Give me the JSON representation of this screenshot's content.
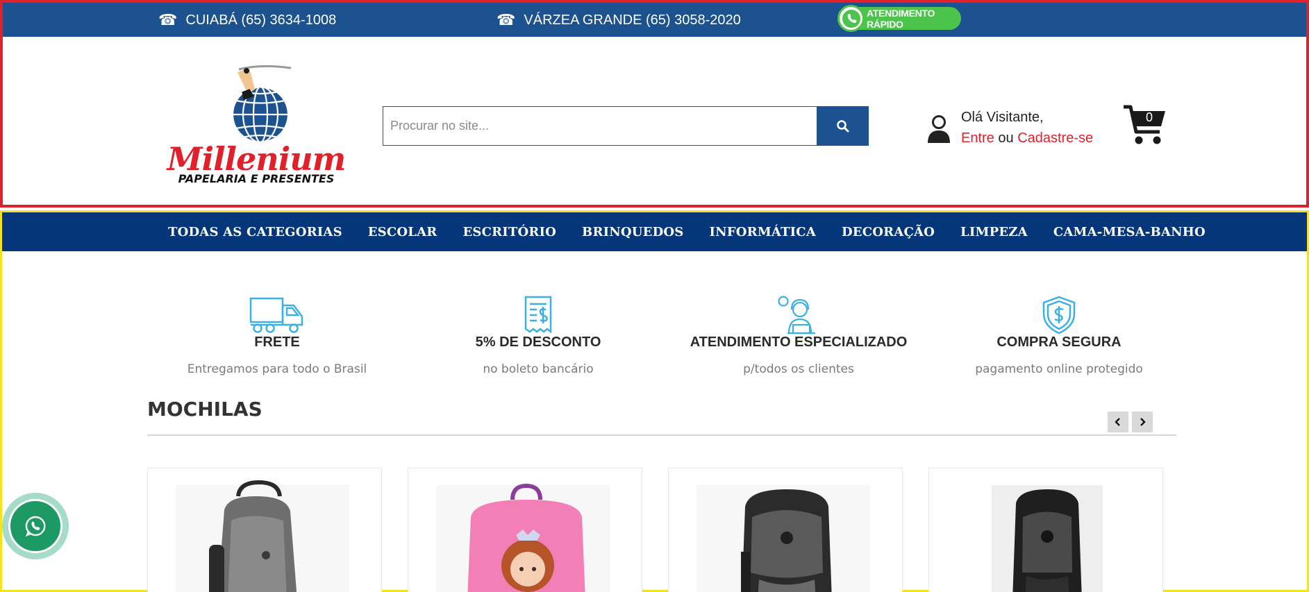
{
  "topbar": {
    "phones": [
      {
        "label": "CUIABÁ (65) 3634-1008",
        "icon": "phone-icon"
      },
      {
        "label": "VÁRZEA GRANDE (65) 3058-2020",
        "icon": "phone-icon"
      }
    ],
    "whatsapp_label": "ATENDIMENTO RÁPIDO"
  },
  "logo": {
    "name": "Millenium",
    "tagline": "PAPELARIA E PRESENTES"
  },
  "search": {
    "placeholder": "Procurar no site...",
    "value": "",
    "button_icon": "search-icon"
  },
  "account": {
    "greeting": "Olá Visitante,",
    "login_label": "Entre",
    "separator": "ou",
    "register_label": "Cadastre-se"
  },
  "cart": {
    "count": "0",
    "icon": "cart-icon"
  },
  "nav": {
    "items": [
      "TODAS AS CATEGORIAS",
      "ESCOLAR",
      "ESCRITÓRIO",
      "BRINQUEDOS",
      "INFORMÁTICA",
      "DECORAÇÃO",
      "LIMPEZA",
      "CAMA-MESA-BANHO"
    ]
  },
  "features": [
    {
      "title": "FRETE",
      "subtitle": "Entregamos para todo o Brasil",
      "icon": "truck-icon"
    },
    {
      "title": "5% DE DESCONTO",
      "subtitle": "no boleto bancário",
      "icon": "receipt-icon"
    },
    {
      "title": "ATENDIMENTO ESPECIALIZADO",
      "subtitle": "p/todos os clientes",
      "icon": "support-agent-icon"
    },
    {
      "title": "COMPRA SEGURA",
      "subtitle": "pagamento online protegido",
      "icon": "shield-dollar-icon"
    }
  ],
  "section": {
    "title": "MOCHILAS",
    "prev_icon": "chevron-left-icon",
    "next_icon": "chevron-right-icon"
  },
  "products": [
    {
      "image": "backpack-gray-image"
    },
    {
      "image": "backpack-pink-princess-image"
    },
    {
      "image": "backpack-black-gray-image"
    },
    {
      "image": "backpack-black-image"
    }
  ],
  "colors": {
    "brand_blue": "#1c5290",
    "nav_blue": "#05367a",
    "brand_red": "#e0202a",
    "whatsapp_green": "#4cc44c",
    "feature_icon": "#3ab0e6"
  }
}
